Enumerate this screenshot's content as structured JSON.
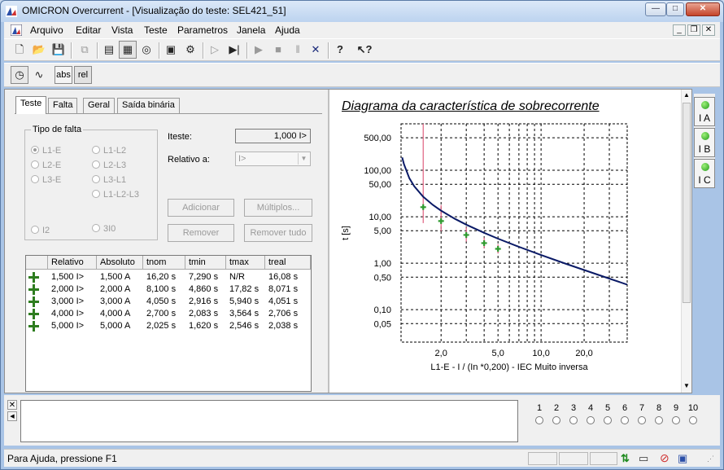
{
  "window": {
    "title": "OMICRON Overcurrent - [Visualização do teste: SEL421_51]"
  },
  "menu": [
    "Arquivo",
    "Editar",
    "Vista",
    "Teste",
    "Parametros",
    "Janela",
    "Ajuda"
  ],
  "toolbar2": {
    "abs_label": "abs",
    "rel_label": "rel"
  },
  "tabs": [
    "Teste",
    "Falta",
    "Geral",
    "Saída binária"
  ],
  "fault_type": {
    "legend": "Tipo de falta",
    "options": [
      "L1-E",
      "L2-E",
      "L3-E",
      "L1-L2",
      "L2-L3",
      "L3-L1",
      "L1-L2-L3",
      "I2",
      "3I0"
    ],
    "selected": "L1-E"
  },
  "form": {
    "itest_label": "Iteste:",
    "itest_value": "1,000 I>",
    "relative_label": "Relativo a:",
    "relative_value": "I>"
  },
  "buttons": {
    "add": "Adicionar",
    "multiple": "Múltiplos...",
    "remove": "Remover",
    "remove_all": "Remover tudo"
  },
  "table": {
    "headers": [
      "Relativo",
      "Absoluto",
      "tnom",
      "tmin",
      "tmax",
      "treal"
    ],
    "rows": [
      [
        "1,500 I>",
        "1,500 A",
        "16,20 s",
        "7,290 s",
        "N/R",
        "16,08 s"
      ],
      [
        "2,000 I>",
        "2,000 A",
        "8,100 s",
        "4,860 s",
        "17,82 s",
        "8,071 s"
      ],
      [
        "3,000 I>",
        "3,000 A",
        "4,050 s",
        "2,916 s",
        "5,940 s",
        "4,051 s"
      ],
      [
        "4,000 I>",
        "4,000 A",
        "2,700 s",
        "2,083 s",
        "3,564 s",
        "2,706 s"
      ],
      [
        "5,000 I>",
        "5,000 A",
        "2,025 s",
        "1,620 s",
        "2,546 s",
        "2,038 s"
      ]
    ]
  },
  "chart_data": {
    "type": "line",
    "title": "Diagrama da característica de sobrecorrente",
    "xlabel": "L1-E - I / (In *0,200)  - IEC Muito inversa",
    "ylabel": "t [s]",
    "x_scale": "log",
    "y_scale": "log",
    "xlim": [
      1.05,
      40
    ],
    "ylim": [
      0.02,
      1000
    ],
    "x_ticks": [
      "2,0",
      "5,0",
      "10,0",
      "20,0"
    ],
    "x_tick_values": [
      2,
      5,
      10,
      20
    ],
    "y_ticks": [
      "500,00",
      "100,00",
      "50,00",
      "10,00",
      "5,00",
      "1,00",
      "0,50",
      "0,10",
      "0,05"
    ],
    "y_tick_values": [
      500,
      100,
      50,
      10,
      5,
      1,
      0.5,
      0.1,
      0.05
    ],
    "grid": true,
    "curve_color": "#0a1a66",
    "series": [
      {
        "x": [
          1.07,
          1.1,
          1.2,
          1.3,
          1.5,
          1.75,
          2,
          2.5,
          3,
          4,
          5,
          7,
          10,
          15,
          20,
          30,
          40
        ],
        "y": [
          189.3,
          135,
          67.5,
          45,
          27,
          18,
          13.5,
          9,
          6.75,
          4.5,
          3.375,
          2.25,
          1.5,
          0.964,
          0.711,
          0.466,
          0.346
        ]
      }
    ],
    "test_points": {
      "x": [
        1.5,
        2,
        3,
        4,
        5
      ],
      "y": [
        16.08,
        8.071,
        4.051,
        2.706,
        2.038
      ],
      "color": "#2e9a2e"
    },
    "tolerance_lines": {
      "x": [
        1.5,
        2,
        3,
        4,
        5
      ],
      "ymin": [
        7.29,
        4.86,
        2.916,
        2.083,
        1.62
      ],
      "ymax": [
        1000,
        17.82,
        5.94,
        3.564,
        2.546
      ],
      "color": "#e06080"
    }
  },
  "indicators": [
    "I A",
    "I B",
    "I C"
  ],
  "binary_outputs": [
    "1",
    "2",
    "3",
    "4",
    "5",
    "6",
    "7",
    "8",
    "9",
    "10"
  ],
  "status": {
    "text": "Para Ajuda, pressione F1"
  }
}
